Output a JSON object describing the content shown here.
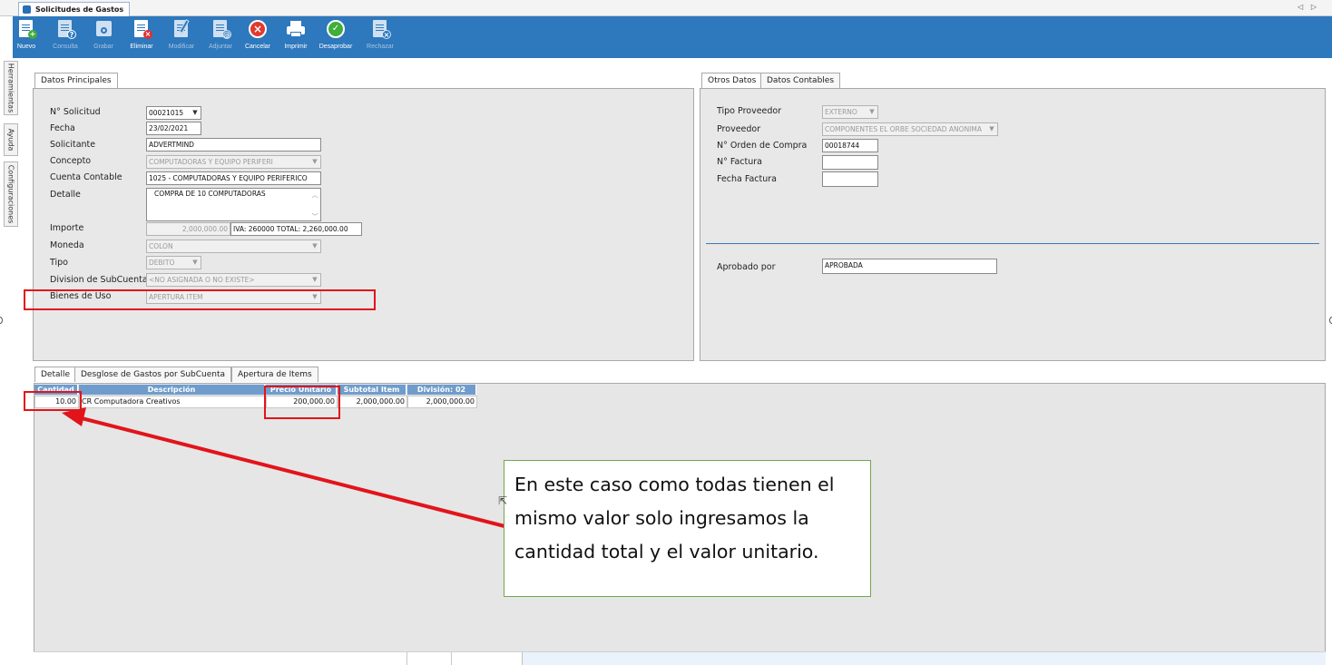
{
  "window": {
    "tab_title": "Solicitudes de Gastos",
    "nav_arrows": "◁ ▷"
  },
  "toolbar": {
    "buttons": [
      {
        "label": "Nuevo",
        "icon": "new-doc-icon",
        "enabled": true
      },
      {
        "label": "Consulta",
        "icon": "query-doc-icon",
        "enabled": false
      },
      {
        "label": "Grabar",
        "icon": "save-icon",
        "enabled": false
      },
      {
        "label": "Eliminar",
        "icon": "delete-doc-icon",
        "enabled": true
      },
      {
        "label": "Modificar",
        "icon": "edit-icon",
        "enabled": false
      },
      {
        "label": "Adjuntar",
        "icon": "attach-icon",
        "enabled": false
      },
      {
        "label": "Cancelar",
        "icon": "cancel-icon",
        "enabled": true
      },
      {
        "label": "Imprimir",
        "icon": "printer-icon",
        "enabled": true
      },
      {
        "label": "Desaprobar",
        "icon": "disapprove-icon",
        "enabled": true
      },
      {
        "label": "Rechazar",
        "icon": "reject-icon",
        "enabled": false
      }
    ],
    "color": "#2e78bd"
  },
  "side_tabs": [
    "Herramientas",
    "Ayuda",
    "Configuraciones"
  ],
  "main_panel": {
    "tab": "Datos Principales",
    "labels": {
      "solicitud": "N° Solicitud",
      "fecha": "Fecha",
      "solicitante": "Solicitante",
      "concepto": "Concepto",
      "cuenta": "Cuenta Contable",
      "detalle": "Detalle",
      "importe": "Importe",
      "moneda": "Moneda",
      "tipo": "Tipo",
      "division": "Division de SubCuentas",
      "bienes": "Bienes de Uso"
    },
    "values": {
      "solicitud": "00021015",
      "fecha": "23/02/2021",
      "solicitante": "ADVERTMIND",
      "concepto": "COMPUTADORAS Y EQUIPO PERIFERI",
      "cuenta": "1025 - COMPUTADORAS Y EQUIPO PERIFERICO",
      "detalle": "COMPRA DE 10 COMPUTADORAS",
      "importe": "2,000,000.00",
      "iva_total": "IVA: 260000 TOTAL:  2,260,000.00",
      "moneda": "COLON",
      "tipo": "DEBITO",
      "division": "<NO ASIGNADA O NO EXISTE>",
      "bienes": "APERTURA ITEM"
    }
  },
  "side_panel": {
    "tabs": [
      "Otros Datos",
      "Datos Contables"
    ],
    "labels": {
      "tipo_proveedor": "Tipo Proveedor",
      "proveedor": "Proveedor",
      "orden": "N° Orden de Compra",
      "factura": "N° Factura",
      "fecha_factura": "Fecha Factura",
      "aprobado": "Aprobado por"
    },
    "values": {
      "tipo_proveedor": "EXTERNO",
      "proveedor": "COMPONENTES EL ORBE SOCIEDAD ANONIMA",
      "orden": "00018744",
      "factura": "",
      "fecha_factura": "",
      "aprobado": "APROBADA"
    }
  },
  "detail_tabs": [
    "Detalle",
    "Desglose de Gastos por SubCuenta",
    "Apertura de Items"
  ],
  "grid": {
    "columns": [
      "Cantidad",
      "Descripción",
      "Precio Unitario",
      "Subtotal Item",
      "División: 02"
    ],
    "rows": [
      [
        "10.00",
        "CR Computadora Creativos",
        "200,000.00",
        "2,000,000.00",
        "2,000,000.00"
      ]
    ]
  },
  "annotation": {
    "note": "En este caso como todas tienen el mismo valor solo ingresamos la cantidad total y el valor unitario.",
    "highlight_color": "#e2141b",
    "note_border_color": "#6ea84a"
  }
}
